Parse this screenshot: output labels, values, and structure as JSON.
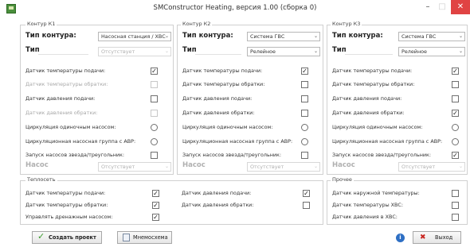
{
  "window": {
    "title": "SMConstructor Heating, версия 1.00 (сборка 0)",
    "min_glyph": "–",
    "max_glyph": "□",
    "close_glyph": "✕"
  },
  "k1": {
    "title": "Контур К1",
    "type_label": "Тип контура:",
    "type_value": "Насосная станция / ХВС",
    "subtype_label": "Тип",
    "subtype_value": "Отсутствует",
    "rows": [
      {
        "label": "Датчик температуры подачи:",
        "state": "✓"
      },
      {
        "label": "Датчик температуры обратки:",
        "state": ""
      },
      {
        "label": "Датчик давления подачи:",
        "state": ""
      },
      {
        "label": "Датчик давления обратки:",
        "state": ""
      },
      {
        "label": "Циркуляция одиночным насосом:",
        "state": ""
      },
      {
        "label": "Циркуляционная насосная группа с АВР:",
        "state": ""
      },
      {
        "label": "Запуск насосов звезда/треугольник:",
        "state": ""
      }
    ],
    "pump_label": "Насос",
    "pump_value": "Отсутствует"
  },
  "k2": {
    "title": "Контур К2",
    "type_label": "Тип контура:",
    "type_value": "Система ГВС",
    "subtype_label": "Тип",
    "subtype_value": "Релейное",
    "rows": [
      {
        "label": "Датчик температуры подачи:",
        "state": "✓"
      },
      {
        "label": "Датчик температуры обратки:",
        "state": ""
      },
      {
        "label": "Датчик давления подачи:",
        "state": ""
      },
      {
        "label": "Датчик давления обратки:",
        "state": ""
      },
      {
        "label": "Циркуляция одиночным насосом:",
        "state": ""
      },
      {
        "label": "Циркуляционная насосная группа с АВР:",
        "state": ""
      },
      {
        "label": "Запуск насосов звезда/треугольник:",
        "state": ""
      }
    ],
    "pump_label": "Насос",
    "pump_value": "Отсутствует"
  },
  "k3": {
    "title": "Контур К3",
    "type_label": "Тип контура:",
    "type_value": "Система ГВС",
    "subtype_label": "Тип",
    "subtype_value": "Релейное",
    "rows": [
      {
        "label": "Датчик температуры подачи:",
        "state": "✓"
      },
      {
        "label": "Датчик температуры обратки:",
        "state": ""
      },
      {
        "label": "Датчик давления подачи:",
        "state": ""
      },
      {
        "label": "Датчик давления обратки:",
        "state": "✓"
      },
      {
        "label": "Циркуляция одиночным насосом:",
        "state": ""
      },
      {
        "label": "Циркуляционная насосная группа с АВР:",
        "state": ""
      },
      {
        "label": "Запуск насосов звезда/треугольник:",
        "state": "✓"
      }
    ],
    "pump_label": "Насос",
    "pump_value": "Отсутствует"
  },
  "heat": {
    "title": "Теплосеть",
    "left": [
      {
        "label": "Датчик температуры подачи:",
        "state": "✓"
      },
      {
        "label": "Датчик температуры обратки:",
        "state": "✓"
      },
      {
        "label": "Управлять дренажным насосом:",
        "state": "✓"
      }
    ],
    "right": [
      {
        "label": "Датчик давления подачи:",
        "state": "✓"
      },
      {
        "label": "Датчик давления обратки:",
        "state": ""
      }
    ]
  },
  "other": {
    "title": "Прочее",
    "rows": [
      {
        "label": "Датчик наружной температуры:",
        "state": ""
      },
      {
        "label": "Датчик температуры ХВС:",
        "state": ""
      },
      {
        "label": "Датчик давления в ХВС:",
        "state": ""
      }
    ]
  },
  "footer": {
    "create_label": "Создать проект",
    "scheme_label": "Мнемосхема",
    "exit_label": "Выход"
  },
  "icons": {
    "checkmark": "✓",
    "arrow": "⌄",
    "exit_x": "✖",
    "info": "i"
  },
  "colors": {
    "close_red": "#e04343",
    "create_green": "#3a9a2c",
    "exit_red": "#c8231e",
    "info_blue": "#2e6fc4"
  }
}
